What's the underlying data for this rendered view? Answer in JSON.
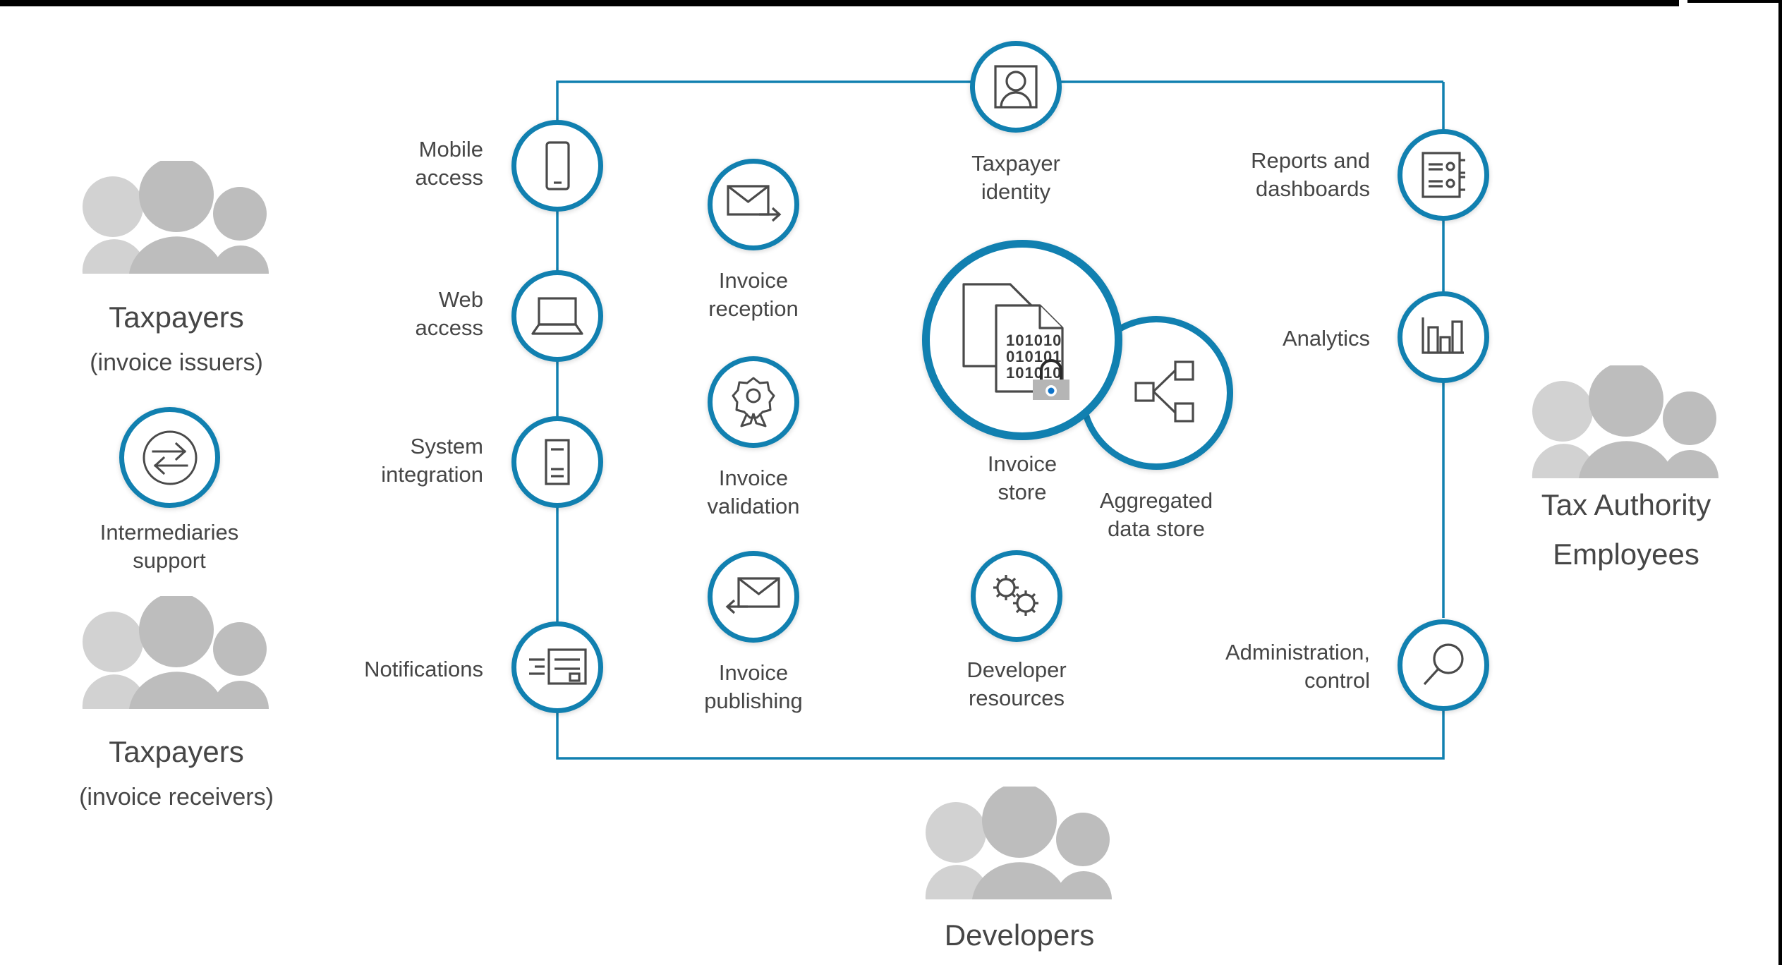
{
  "theme": {
    "accent_blue": "#1180B0",
    "icon_gray": "#4a4a4a",
    "people_gray": "#bdbdbd",
    "people_gray_light": "#d2d2d2",
    "text_gray": "#464646",
    "lock_gray": "#b5b5b5",
    "lock_keyhole_blue": "#0e72c8"
  },
  "actors": {
    "taxpayers_issuers": {
      "line1": "Taxpayers",
      "line2": "(invoice issuers)",
      "icon": "people-group-icon"
    },
    "taxpayers_receivers": {
      "line1": "Taxpayers",
      "line2": "(invoice receivers)",
      "icon": "people-group-icon"
    },
    "tax_authority": {
      "line1": "Tax Authority",
      "line2": "Employees",
      "icon": "people-group-icon"
    },
    "developers": {
      "line1": "Developers",
      "line2": "",
      "icon": "people-group-icon"
    }
  },
  "intermediaries": {
    "label": "Intermediaries\nsupport",
    "icon": "exchange-arrows-icon"
  },
  "channels": [
    {
      "id": "mobile-access",
      "label": "Mobile\naccess",
      "icon": "mobile-phone-icon"
    },
    {
      "id": "web-access",
      "label": "Web\naccess",
      "icon": "laptop-icon"
    },
    {
      "id": "system-integration",
      "label": "System\nintegration",
      "icon": "server-rack-icon"
    },
    {
      "id": "notifications",
      "label": "Notifications",
      "icon": "notification-card-icon"
    }
  ],
  "processing": [
    {
      "id": "invoice-reception",
      "label": "Invoice\nreception",
      "icon": "envelope-arrow-right-icon"
    },
    {
      "id": "invoice-validation",
      "label": "Invoice\nvalidation",
      "icon": "certificate-seal-icon"
    },
    {
      "id": "invoice-publishing",
      "label": "Invoice\npublishing",
      "icon": "envelope-arrow-left-icon"
    }
  ],
  "core": {
    "taxpayer_identity": {
      "label": "Taxpayer\nidentity",
      "icon": "person-id-badge-icon"
    },
    "invoice_store": {
      "label": "Invoice\nstore",
      "icon": "secure-documents-icon",
      "binary_rows": [
        "101010",
        "010101",
        "101010"
      ]
    },
    "aggregated_store": {
      "label": "Aggregated\ndata store",
      "icon": "share-nodes-icon"
    },
    "developer_resources": {
      "label": "Developer\nresources",
      "icon": "gears-icon"
    }
  },
  "outputs": [
    {
      "id": "reports-dashboards",
      "label": "Reports and\ndashboards",
      "icon": "report-document-icon"
    },
    {
      "id": "analytics",
      "label": "Analytics",
      "icon": "bar-chart-icon"
    },
    {
      "id": "administration",
      "label": "Administration,\ncontrol",
      "icon": "magnifier-icon"
    }
  ]
}
